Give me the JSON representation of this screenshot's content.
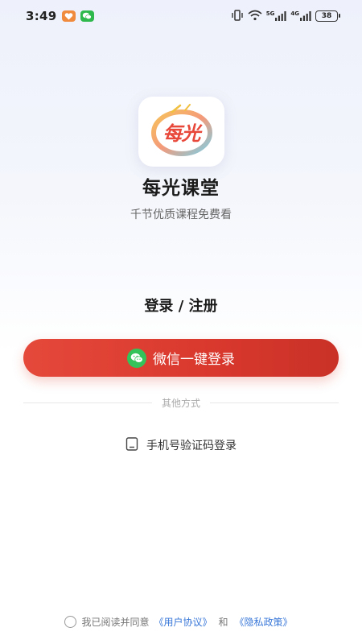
{
  "status_bar": {
    "time": "3:49",
    "battery": "38",
    "network_5g": "5G",
    "network_4g": "4G",
    "icons": [
      "vibrate-icon",
      "wifi-icon",
      "signal-5g-icon",
      "signal-4g-icon",
      "battery-icon"
    ]
  },
  "app": {
    "logo_text": "每光",
    "name": "每光课堂",
    "slogan": "千节优质课程免费看"
  },
  "login": {
    "title": "登录 / 注册",
    "wechat_button": "微信一键登录",
    "other_methods": "其他方式",
    "phone_login": "手机号验证码登录"
  },
  "agreement": {
    "prefix": "我已阅读并同意",
    "user_agreement": "《用户协议》",
    "and": "和",
    "privacy_policy": "《隐私政策》"
  },
  "colors": {
    "accent_red": "#d9382d",
    "wechat_green": "#34c35a",
    "link_blue": "#3a78d8"
  }
}
